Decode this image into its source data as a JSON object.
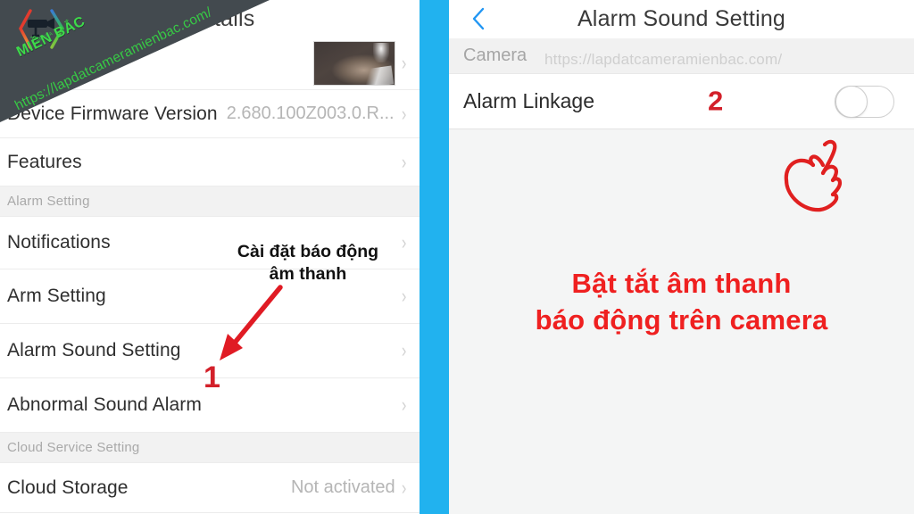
{
  "left_panel": {
    "title": "tails",
    "rows": [
      {
        "type": "thumbnail",
        "name": "device-thumbnail",
        "label": "",
        "value": "",
        "chevron": "›"
      },
      {
        "type": "value",
        "name": "device-firmware-version",
        "label": "Device Firmware Version",
        "value": "2.680.100Z003.0.R....",
        "chevron": "›"
      },
      {
        "type": "link",
        "name": "features",
        "label": "Features",
        "value": "",
        "chevron": "›"
      },
      {
        "type": "section",
        "name": "alarm-setting-section",
        "label": "Alarm Setting",
        "value": "",
        "chevron": ""
      },
      {
        "type": "link",
        "name": "notifications",
        "label": "Notifications",
        "value": "",
        "chevron": "›"
      },
      {
        "type": "link",
        "name": "arm-setting",
        "label": "Arm Setting",
        "value": "",
        "chevron": "›"
      },
      {
        "type": "link",
        "name": "alarm-sound-setting",
        "label": "Alarm Sound Setting",
        "value": "",
        "chevron": "›"
      },
      {
        "type": "link",
        "name": "abnormal-sound-alarm",
        "label": "Abnormal Sound Alarm",
        "value": "",
        "chevron": "›"
      },
      {
        "type": "section",
        "name": "cloud-service-setting-section",
        "label": "Cloud Service Setting",
        "value": "",
        "chevron": ""
      },
      {
        "type": "value",
        "name": "cloud-storage",
        "label": "Cloud Storage",
        "value": "Not activated",
        "chevron": "›"
      }
    ],
    "annotation": {
      "caption_line1": "Cài đặt báo động",
      "caption_line2": "âm thanh",
      "step_number": "1",
      "arrow_color": "#e01b24"
    }
  },
  "right_panel": {
    "back_icon": "chevron-left-icon",
    "title": "Alarm Sound Setting",
    "section": {
      "label": "Camera",
      "url": "https://lapdatcameramienbac.com/"
    },
    "row": {
      "label": "Alarm Linkage",
      "step_number": "2",
      "toggle_state": "off"
    },
    "annotation": {
      "caption_line1": "Bật tắt âm thanh",
      "caption_line2": "báo động trên camera",
      "hand_icon": "pointing-hand-icon",
      "caption_color": "#ef2020"
    }
  },
  "watermark": {
    "brand": "MIỀN BẮC",
    "url": "https://lapdatcameramienbac.com/",
    "logo_icon": "hexagon-camera-logo-icon",
    "brand_color": "#3ddb4a",
    "panel_color": "#434a4f"
  },
  "theme": {
    "divider_color": "#21b2ef",
    "accent_red": "#d3202a",
    "page_background": "#f4f5f5"
  }
}
